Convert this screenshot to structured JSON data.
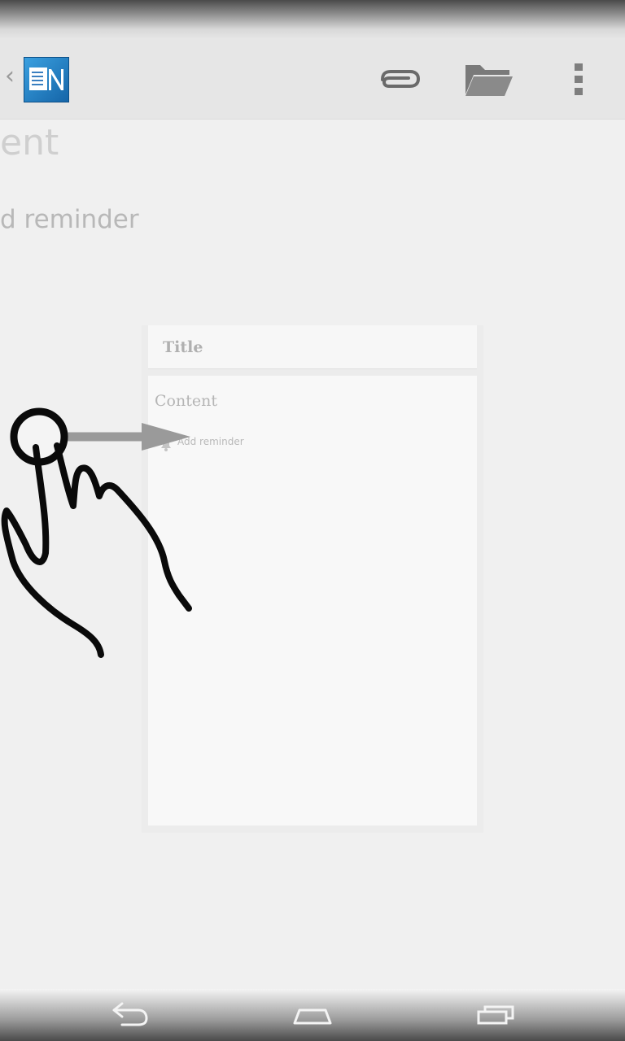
{
  "app": {
    "up_caret": "‹",
    "logo_icon": "onenote-style-notes-logo"
  },
  "action_bar": {
    "attach_icon": "paperclip-icon",
    "folder_icon": "folder-icon",
    "overflow_icon": "overflow-menu-icon"
  },
  "background": {
    "title_fragment": "ent",
    "reminder_fragment": "d reminder"
  },
  "editor_preview": {
    "title_placeholder": "Title",
    "content_placeholder": "Content",
    "reminder_label": "Add reminder"
  },
  "overlay": {
    "gesture_icon": "swipe-right-hand-icon"
  },
  "nav": {
    "back_icon": "back-icon",
    "home_icon": "home-icon",
    "recents_icon": "recents-icon"
  }
}
